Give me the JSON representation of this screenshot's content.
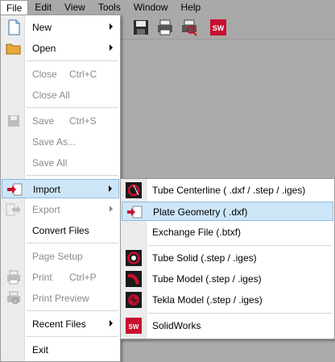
{
  "menubar": {
    "items": [
      "File",
      "Edit",
      "View",
      "Tools",
      "Window",
      "Help"
    ]
  },
  "file_menu": {
    "new": "New",
    "open": "Open",
    "close": "Close",
    "close_shortcut": "Ctrl+C",
    "close_all": "Close All",
    "save": "Save",
    "save_shortcut": "Ctrl+S",
    "save_as": "Save As...",
    "save_all": "Save All",
    "import": "Import",
    "export": "Export",
    "convert_files": "Convert Files",
    "page_setup": "Page Setup",
    "print": "Print",
    "print_shortcut": "Ctrl+P",
    "print_preview": "Print Preview",
    "recent_files": "Recent Files",
    "exit": "Exit"
  },
  "import_menu": {
    "tube_centerline": "Tube Centerline ( .dxf / .step / .iges)",
    "plate_geometry": "Plate Geometry ( .dxf)",
    "exchange_file": "Exchange File (.btxf)",
    "tube_solid": "Tube Solid (.step / .iges)",
    "tube_model": "Tube Model (.step / .iges)",
    "tekla_model": "Tekla Model (.step / .iges)",
    "solidworks": "SolidWorks"
  },
  "colors": {
    "accent_red": "#c8102e",
    "hover_bg": "#cde6f7",
    "hover_border": "#8bbde4"
  },
  "toolbar_icon_names": [
    "save-icon",
    "print-icon",
    "print-preview-icon",
    "solidworks-icon"
  ]
}
